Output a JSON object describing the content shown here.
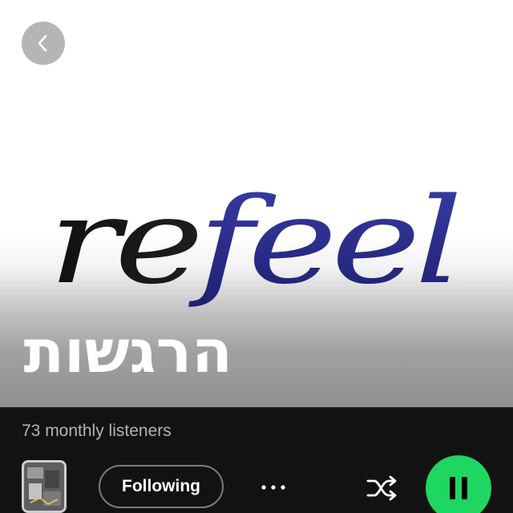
{
  "header": {
    "back_icon": "chevron-left-icon"
  },
  "hero": {
    "logo_text": "refeel",
    "artist_name": "הרגשות"
  },
  "stats": {
    "monthly_listeners": "73 monthly listeners"
  },
  "controls": {
    "follow_label": "Following",
    "more_icon": "more-options-icon",
    "shuffle_icon": "shuffle-icon",
    "play_icon": "pause-icon"
  },
  "colors": {
    "accent_green": "#1ed760",
    "background": "#121212",
    "muted_text": "#b3b3b3",
    "logo_navy": "#2a2c8c"
  }
}
